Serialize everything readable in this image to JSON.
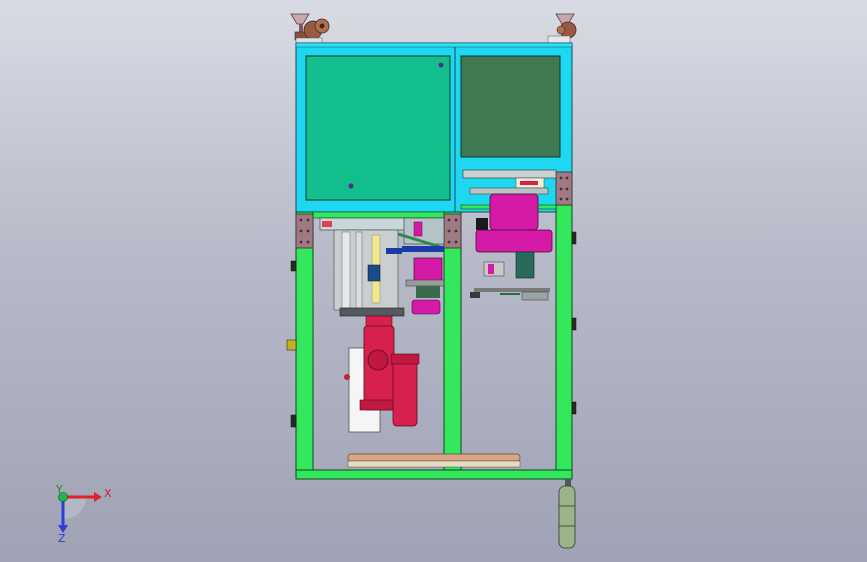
{
  "triad": {
    "x_label": "X",
    "y_label": "Y",
    "z_label": "Z"
  },
  "colors": {
    "background_top": "#d9dbe4",
    "background_bottom": "#9ea2b4",
    "frame_green": "#33e85c",
    "cabinet_cyan": "#1ed7f0",
    "panel_left": "#12be8c",
    "panel_right": "#3f7a52",
    "cylinder_red": "#d8204e",
    "magenta": "#d61aa8",
    "bracket_brown": "#a07a82",
    "axis_x": "#e0202a",
    "axis_y": "#1fb84a",
    "axis_z": "#2a3fd8"
  }
}
